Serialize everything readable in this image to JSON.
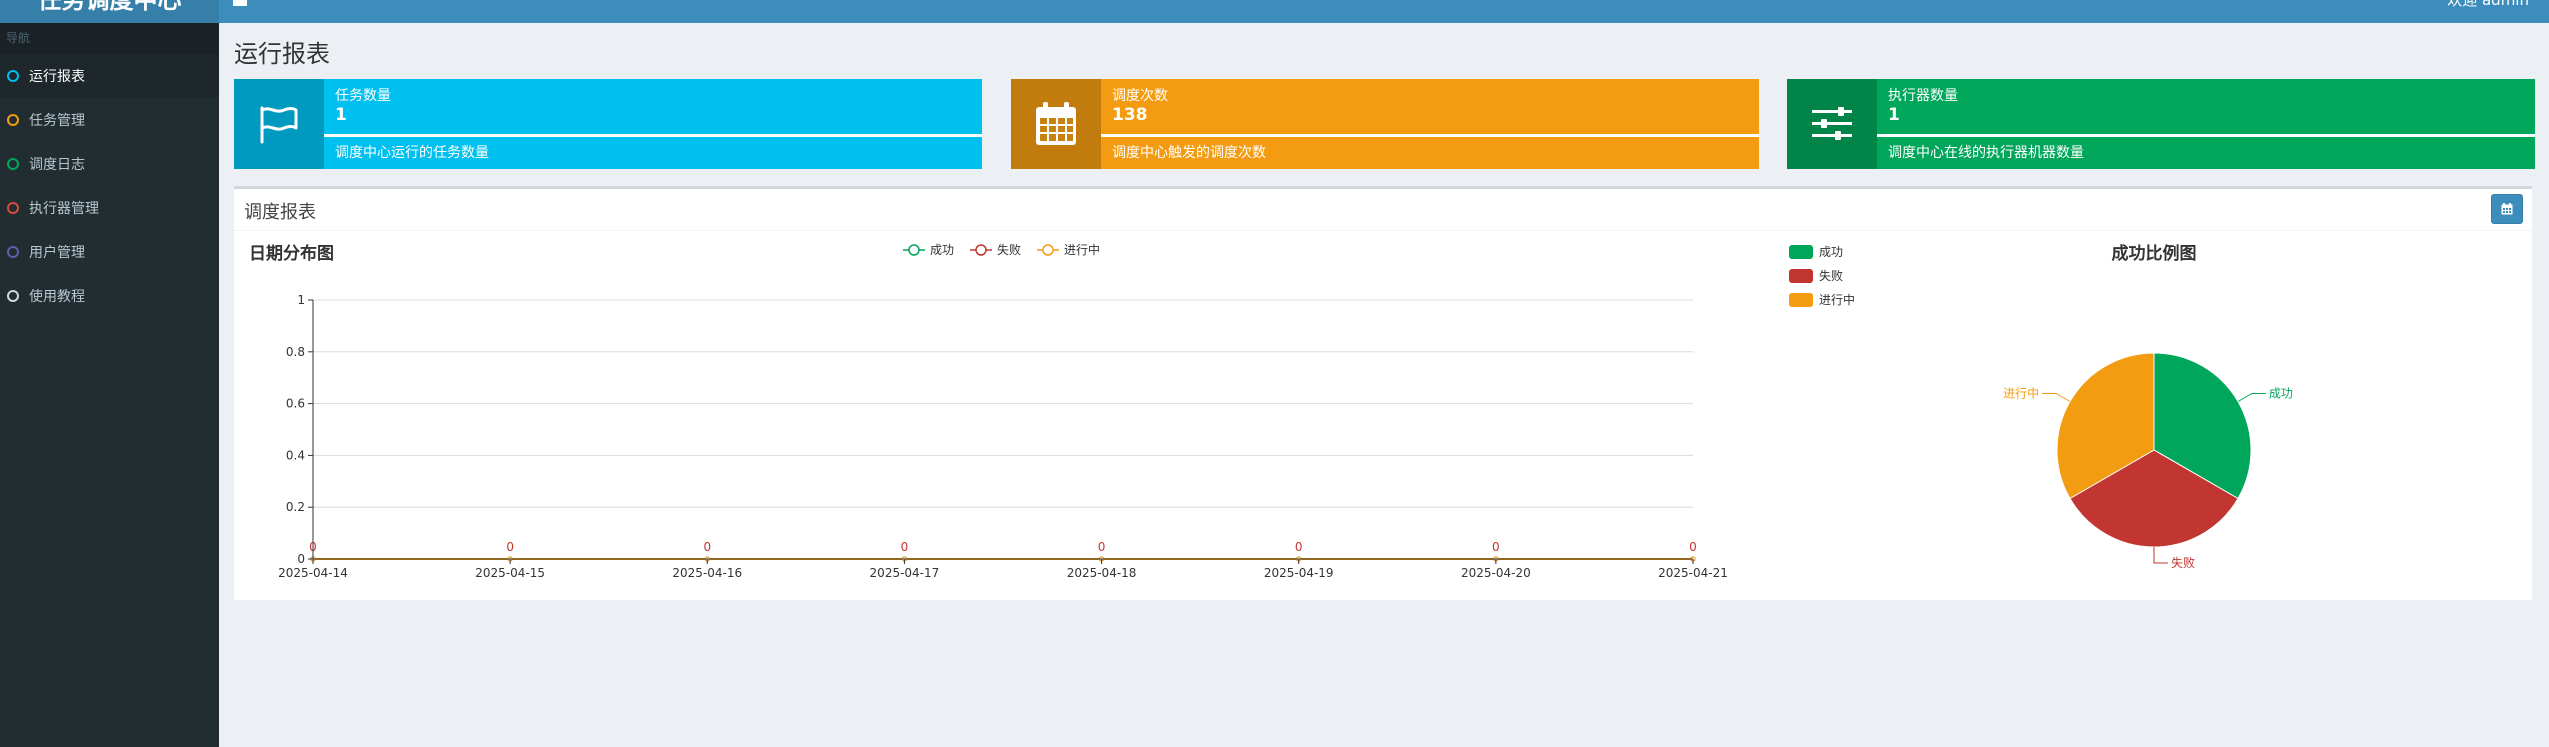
{
  "header": {
    "logo": "任务调度中心",
    "welcome": "欢迎 admin",
    "brand_color": "#3c8dbc"
  },
  "sidebar": {
    "header": "导航",
    "items": [
      {
        "label": "运行报表",
        "icon": "circle-icon",
        "color": "#00c0ef",
        "active": true
      },
      {
        "label": "任务管理",
        "icon": "circle-icon",
        "color": "#f39c12",
        "active": false
      },
      {
        "label": "调度日志",
        "icon": "circle-icon",
        "color": "#00a65a",
        "active": false
      },
      {
        "label": "执行器管理",
        "icon": "circle-icon",
        "color": "#dd4b39",
        "active": false
      },
      {
        "label": "用户管理",
        "icon": "circle-icon",
        "color": "#605ca8",
        "active": false
      },
      {
        "label": "使用教程",
        "icon": "circle-icon",
        "color": "#d2d6de",
        "active": false
      }
    ]
  },
  "page": {
    "title": "运行报表"
  },
  "info_boxes": [
    {
      "label": "任务数量",
      "value": "1",
      "desc": "调度中心运行的任务数量",
      "icon": "flag-icon",
      "color": "#00c0ef",
      "progress": 1.0
    },
    {
      "label": "调度次数",
      "value": "138",
      "desc": "调度中心触发的调度次数",
      "icon": "calendar-icon",
      "color": "#f39c12",
      "progress": 1.0
    },
    {
      "label": "执行器数量",
      "value": "1",
      "desc": "调度中心在线的执行器机器数量",
      "icon": "sliders-icon",
      "color": "#00a65a",
      "progress": 1.0
    }
  ],
  "report": {
    "title": "调度报表",
    "filter_icon": "calendar-icon",
    "line_chart_title": "日期分布图",
    "pie_chart_title": "成功比例图",
    "pie_legend": [
      "成功",
      "失败",
      "进行中"
    ]
  },
  "chart_data": [
    {
      "type": "line",
      "title": "日期分布图",
      "categories": [
        "2025-04-14",
        "2025-04-15",
        "2025-04-16",
        "2025-04-17",
        "2025-04-18",
        "2025-04-19",
        "2025-04-20",
        "2025-04-21"
      ],
      "series": [
        {
          "name": "成功",
          "color": "#00a65a",
          "values": [
            0,
            0,
            0,
            0,
            0,
            0,
            0,
            0
          ]
        },
        {
          "name": "失败",
          "color": "#c23632",
          "values": [
            0,
            0,
            0,
            0,
            0,
            0,
            0,
            0
          ]
        },
        {
          "name": "进行中",
          "color": "#f39c12",
          "values": [
            0,
            0,
            0,
            0,
            0,
            0,
            0,
            0
          ]
        }
      ],
      "ylim": [
        0,
        1
      ],
      "yticks": [
        "0",
        "0.2",
        "0.4",
        "0.6",
        "0.8",
        "1"
      ],
      "grid": true,
      "legend": "top-center"
    },
    {
      "type": "pie",
      "title": "成功比例图",
      "slices": [
        {
          "name": "成功",
          "value": 1,
          "color": "#00a65a"
        },
        {
          "name": "失败",
          "value": 1,
          "color": "#c23632"
        },
        {
          "name": "进行中",
          "value": 1,
          "color": "#f39c12"
        }
      ],
      "legend": "top-left"
    }
  ]
}
